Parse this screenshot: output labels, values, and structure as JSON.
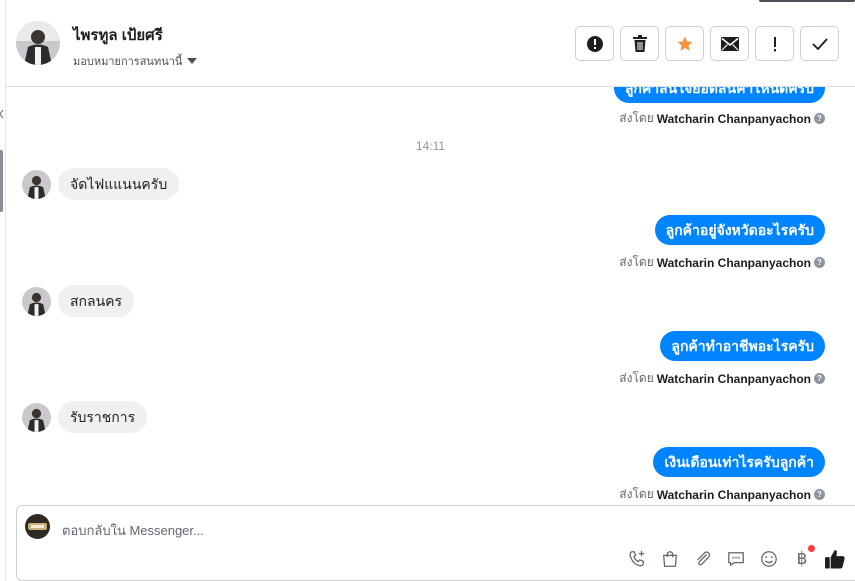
{
  "header": {
    "contact_name": "ไพรทูล เป้ยศรี",
    "assign_label": "มอบหมายการสนทนานี้",
    "toolbar_icons": [
      "alert-icon",
      "trash-icon",
      "star-icon",
      "envelope-icon",
      "exclamation-icon",
      "check-icon"
    ],
    "star_color": "#f7923b"
  },
  "conversation": {
    "top_partial_message": "ลูกค้าสนใจยอดสินค้าไหนดีครับ",
    "sent_by_prefix": "ส่งโดย",
    "agent_name": "Watcharin Chanpanyachon",
    "timestamp": "14:11",
    "messages": [
      {
        "direction": "in",
        "text": "จัดไฟแแนนครับ"
      },
      {
        "direction": "out",
        "text": "ลูกค้าอยู่จังหวัดอะไรครับ"
      },
      {
        "direction": "in",
        "text": "สกลนคร"
      },
      {
        "direction": "out",
        "text": "ลูกค้าทำอาชีพอะไรครับ"
      },
      {
        "direction": "in",
        "text": "รับราชการ"
      },
      {
        "direction": "out",
        "text": "เงินเดือนเท่าไรครับลูกค้า"
      }
    ],
    "accent_color": "#0084ff"
  },
  "composer": {
    "placeholder": "ตอบกลับใน Messenger...",
    "icons": [
      "phone-plus-icon",
      "shopping-bag-icon",
      "paperclip-icon",
      "chat-bubble-icon",
      "smiley-icon",
      "baht-icon",
      "thumbs-up-icon"
    ],
    "currency_symbol": "฿"
  }
}
